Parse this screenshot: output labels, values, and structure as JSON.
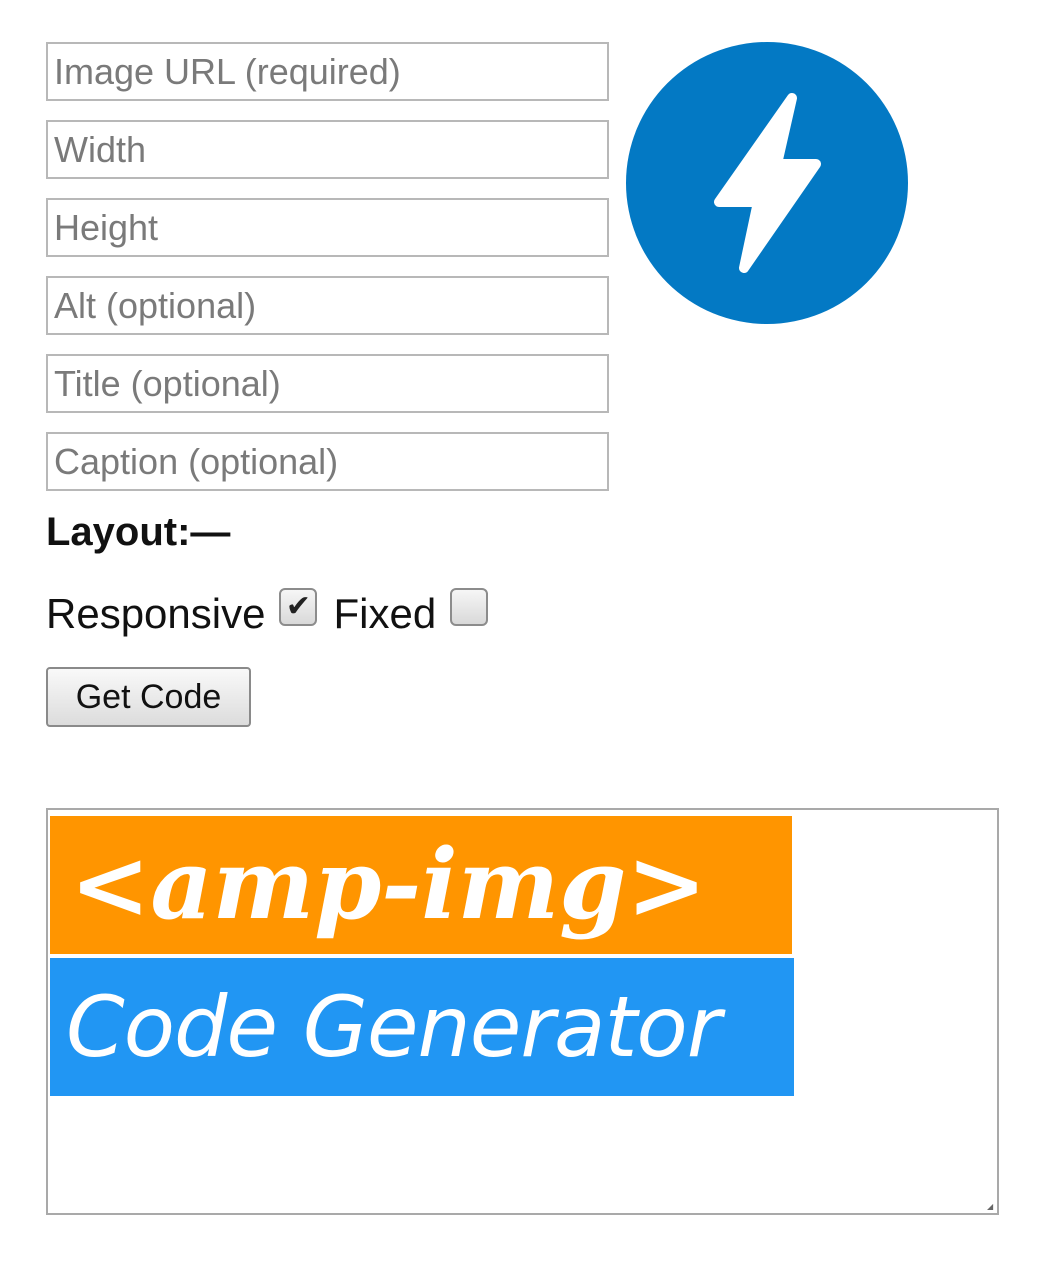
{
  "form": {
    "fields": [
      {
        "placeholder": "Image URL (required)",
        "value": ""
      },
      {
        "placeholder": "Width",
        "value": ""
      },
      {
        "placeholder": "Height",
        "value": ""
      },
      {
        "placeholder": "Alt (optional)",
        "value": ""
      },
      {
        "placeholder": "Title (optional)",
        "value": ""
      },
      {
        "placeholder": "Caption (optional)",
        "value": ""
      }
    ],
    "layout_label": "Layout:—",
    "options": [
      {
        "label": "Responsive",
        "checked": true
      },
      {
        "label": "Fixed",
        "checked": false
      }
    ],
    "check_mark": "✔",
    "button_label": "Get Code"
  },
  "logo": {
    "icon": "amp-lightning-bolt-icon",
    "circle_color": "#0379c4",
    "bolt_color": "#ffffff"
  },
  "output": {
    "banner_top_text": "<amp-img>",
    "banner_top_color": "#ff9500",
    "banner_bottom_text": "Code Generator",
    "banner_bottom_color": "#2196f3"
  }
}
